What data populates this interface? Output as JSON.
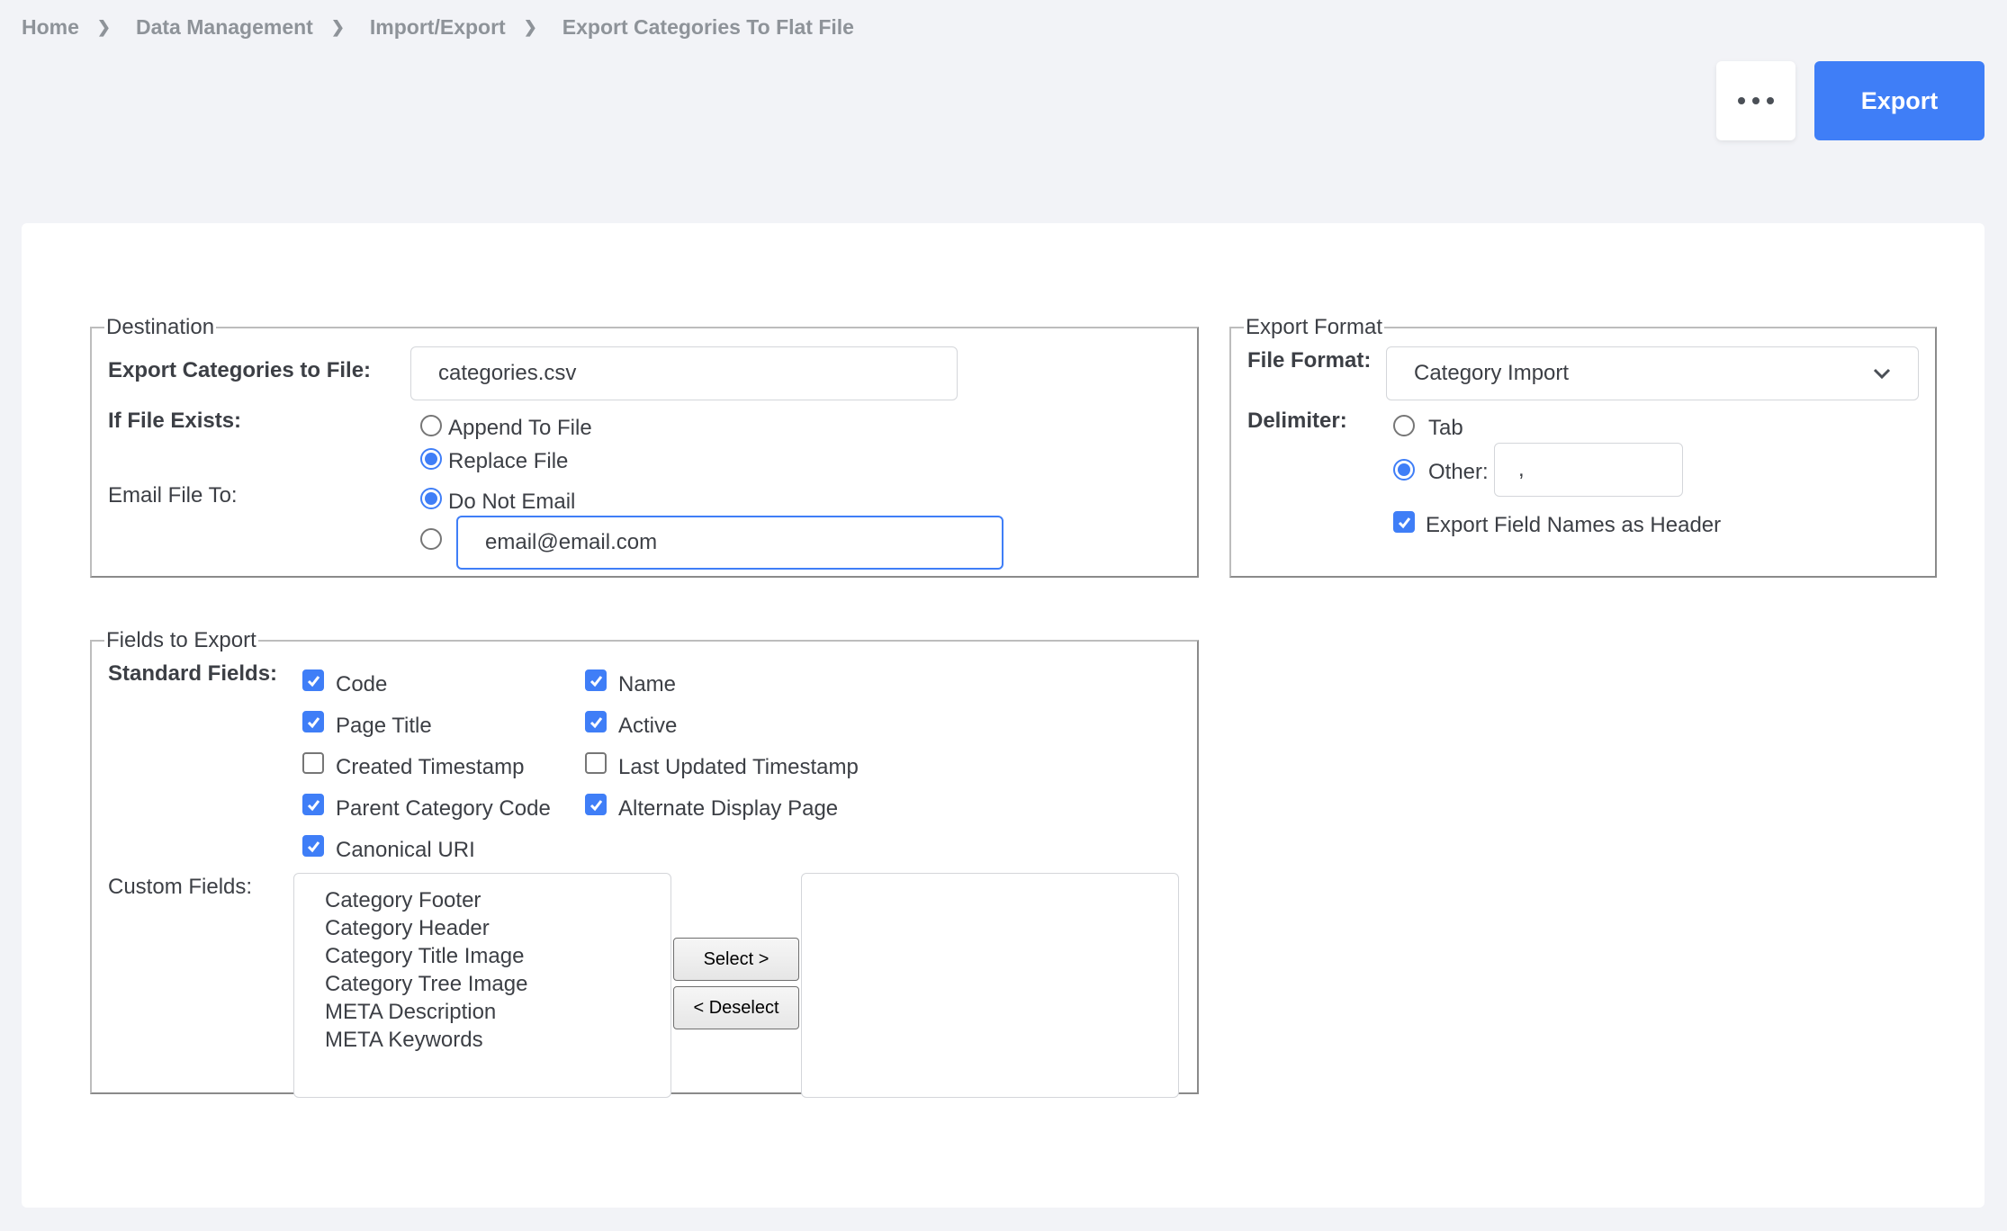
{
  "breadcrumb": [
    "Home",
    "Data Management",
    "Import/Export",
    "Export Categories To Flat File"
  ],
  "toolbar": {
    "export_label": "Export"
  },
  "destination": {
    "legend": "Destination",
    "file_label": "Export Categories to File:",
    "file_value": "categories.csv",
    "if_exists_label": "If File Exists:",
    "append_label": "Append To File",
    "replace_label": "Replace File",
    "email_label": "Email File To:",
    "do_not_email_label": "Do Not Email",
    "email_value": "email@email.com"
  },
  "export_format": {
    "legend": "Export Format",
    "file_format_label": "File Format:",
    "file_format_value": "Category Import",
    "delimiter_label": "Delimiter:",
    "tab_label": "Tab",
    "other_label": "Other:",
    "other_value": ",",
    "header_label": "Export Field Names as Header"
  },
  "fields": {
    "legend": "Fields to Export",
    "standard_label": "Standard Fields:",
    "standard": [
      {
        "label": "Code",
        "checked": true
      },
      {
        "label": "Name",
        "checked": true
      },
      {
        "label": "Page Title",
        "checked": true
      },
      {
        "label": "Active",
        "checked": true
      },
      {
        "label": "Created Timestamp",
        "checked": false
      },
      {
        "label": "Last Updated Timestamp",
        "checked": false
      },
      {
        "label": "Parent Category Code",
        "checked": true
      },
      {
        "label": "Alternate Display Page",
        "checked": true
      },
      {
        "label": "Canonical URI",
        "checked": true
      }
    ],
    "custom_label": "Custom Fields:",
    "available": [
      "Category Footer",
      "Category Header",
      "Category Title Image",
      "Category Tree Image",
      "META Description",
      "META Keywords"
    ],
    "select_label": "Select >",
    "deselect_label": "< Deselect"
  },
  "colors": {
    "accent": "#3f7ef7",
    "background": "#f2f3f7"
  }
}
